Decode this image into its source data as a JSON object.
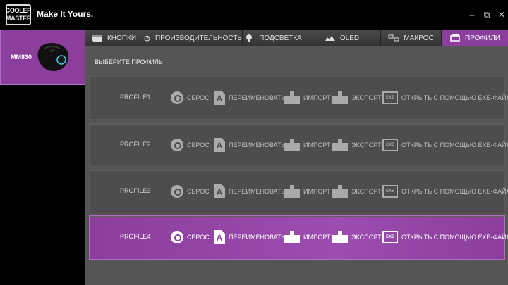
{
  "window": {
    "brand_line1": "COOLER",
    "brand_line2": "MASTER",
    "tagline": "Make It Yours.",
    "controls": {
      "minimize": "‒",
      "maximize": "⧉",
      "close": "✕"
    }
  },
  "device": {
    "name": "MM830"
  },
  "tabs": [
    {
      "label": "КНОПКИ",
      "icon": "mouse-icon",
      "active": false
    },
    {
      "label": "ПРОИЗВОДИТЕЛЬНОСТЬ",
      "icon": "speedometer-icon",
      "active": false
    },
    {
      "label": "ПОДСВЕТКА",
      "icon": "bulb-icon",
      "active": false
    },
    {
      "label": "OLED",
      "icon": "oled-icon",
      "active": false
    },
    {
      "label": "МАКРОС",
      "icon": "macro-icon",
      "active": false
    },
    {
      "label": "ПРОФИЛИ",
      "icon": "profile-icon",
      "active": true
    }
  ],
  "main": {
    "section_label": "ВЫБЕРИТЕ ПРОФИЛЬ",
    "actions": {
      "reset": "СБРОС",
      "rename": "ПЕРЕИМЕНОВАТЬ",
      "import": "ИМПОРТ",
      "export": "ЭКСПОРТ",
      "exe": "ОТКРЫТЬ С ПОМОЩЬЮ EXE-ФАЙЛА",
      "exe_icon_text": "EXE",
      "rename_icon_text": "A"
    },
    "profiles": [
      {
        "name": "PROFILE1",
        "selected": false
      },
      {
        "name": "PROFILE2",
        "selected": false
      },
      {
        "name": "PROFILE3",
        "selected": false
      },
      {
        "name": "PROFILE4",
        "selected": true
      }
    ]
  },
  "colors": {
    "accent": "#8b3e9c",
    "panel": "#555555",
    "row": "#4d4d4d"
  }
}
